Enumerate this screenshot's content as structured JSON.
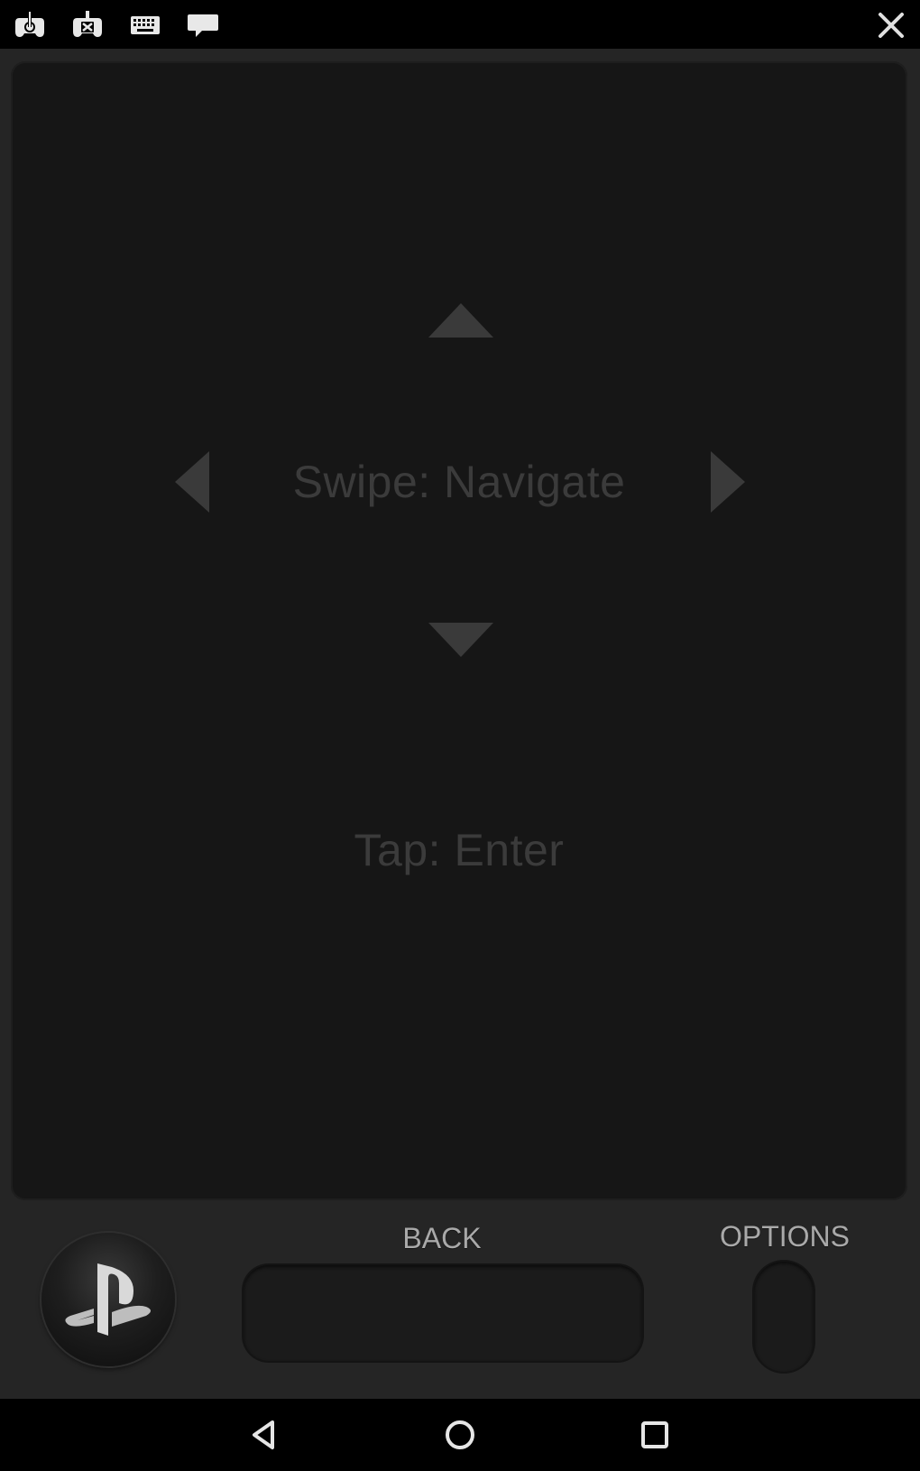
{
  "status_bar": {
    "icons": [
      "controller-power-icon",
      "controller-settings-icon",
      "keyboard-icon",
      "chat-icon",
      "close-icon"
    ]
  },
  "touchpad": {
    "hint_swipe": "Swipe: Navigate",
    "hint_tap": "Tap: Enter",
    "arrows": [
      "up-arrow-icon",
      "left-arrow-icon",
      "right-arrow-icon",
      "down-arrow-icon"
    ]
  },
  "controls": {
    "back_label": "BACK",
    "options_label": "OPTIONS",
    "ps_icon": "playstation-logo-icon"
  },
  "nav_bar": {
    "icons": [
      "back-nav-icon",
      "home-nav-icon",
      "recents-nav-icon"
    ]
  },
  "colors": {
    "background": "#252525",
    "touchpad": "#161616",
    "hint_text": "#3b3b3b",
    "label_text": "#a9a9a9",
    "bars": "#000000"
  }
}
